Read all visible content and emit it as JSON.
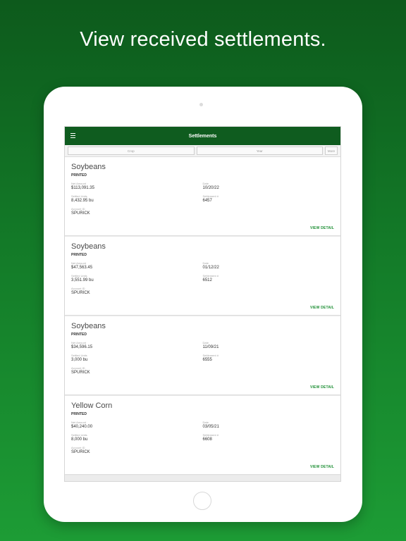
{
  "headline": "View received settlements.",
  "app": {
    "title": "Settlements",
    "filters": {
      "crop": "Crop",
      "year": "Year",
      "more": "More"
    }
  },
  "cards": [
    {
      "title": "Soybeans",
      "status": "PRINTED",
      "net_label": "Net Amount",
      "net": "$113,091.35",
      "date_label": "Date",
      "date": "10/20/22",
      "units_label": "Settled Units",
      "units": "8,432.95 bu",
      "settlement_label": "Settlement #",
      "settlement": "6457",
      "account_label": "Account ID",
      "account": "SPURICK",
      "view_detail": "VIEW DETAIL"
    },
    {
      "title": "Soybeans",
      "status": "PRINTED",
      "net_label": "Net Amount",
      "net": "$47,563.45",
      "date_label": "Date",
      "date": "01/12/22",
      "units_label": "Settled Units",
      "units": "3,551.99 bu",
      "settlement_label": "Settlement #",
      "settlement": "6512",
      "account_label": "Account ID",
      "account": "SPURICK",
      "view_detail": "VIEW DETAIL"
    },
    {
      "title": "Soybeans",
      "status": "PRINTED",
      "net_label": "Net Amount",
      "net": "$34,596.15",
      "date_label": "Date",
      "date": "11/09/21",
      "units_label": "Settled Units",
      "units": "3,000 bu",
      "settlement_label": "Settlement #",
      "settlement": "6555",
      "account_label": "Account ID",
      "account": "SPURICK",
      "view_detail": "VIEW DETAIL"
    },
    {
      "title": "Yellow Corn",
      "status": "PRINTED",
      "net_label": "Net Amount",
      "net": "$40,240.00",
      "date_label": "Date",
      "date": "03/05/21",
      "units_label": "Settled Units",
      "units": "8,000 bu",
      "settlement_label": "Settlement #",
      "settlement": "6608",
      "account_label": "Account ID",
      "account": "SPURICK",
      "view_detail": "VIEW DETAIL"
    }
  ]
}
